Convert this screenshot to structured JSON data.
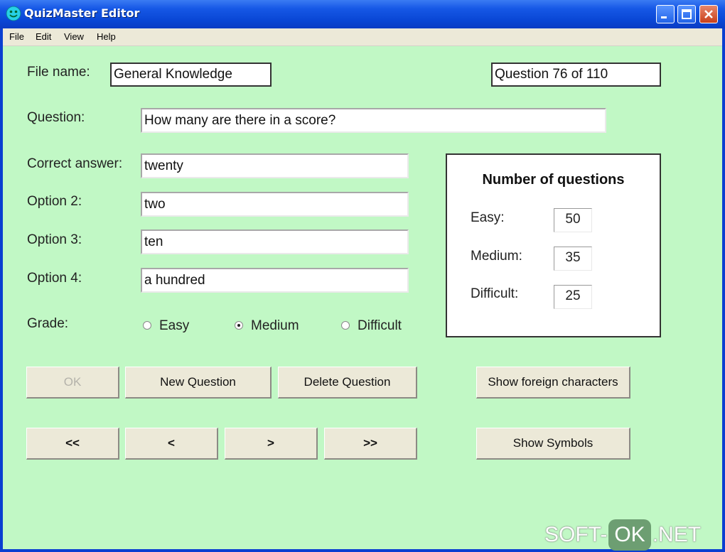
{
  "window": {
    "title": "QuizMaster Editor"
  },
  "menu": [
    "File",
    "Edit",
    "View",
    "Help"
  ],
  "form": {
    "file_name_label": "File name:",
    "file_name": "General Knowledge",
    "question_counter": "Question 76 of 110",
    "question_label": "Question:",
    "question": "How many are there in a score?",
    "correct_label": "Correct answer:",
    "correct": "twenty",
    "option2_label": "Option 2:",
    "option2": "two",
    "option3_label": "Option 3:",
    "option3": "ten",
    "option4_label": "Option 4:",
    "option4": "a hundred",
    "grade_label": "Grade:",
    "grades": [
      {
        "label": "Easy",
        "selected": false
      },
      {
        "label": "Medium",
        "selected": true
      },
      {
        "label": "Difficult",
        "selected": false
      }
    ]
  },
  "stats": {
    "title": "Number of questions",
    "easy_label": "Easy:",
    "easy": "50",
    "medium_label": "Medium:",
    "medium": "35",
    "difficult_label": "Difficult:",
    "difficult": "25"
  },
  "buttons": {
    "ok": "OK",
    "new_question": "New Question",
    "delete_question": "Delete Question",
    "show_foreign": "Show foreign characters",
    "first": "<<",
    "prev": "<",
    "next": ">",
    "last": ">>",
    "show_symbols": "Show Symbols"
  },
  "watermark": {
    "left": "SOFT-",
    "mid": "OK",
    "right": ".NET"
  },
  "colors": {
    "background": "#c1f8c5",
    "titlebar": "#0a47d6",
    "button_face": "#ece9d8"
  }
}
